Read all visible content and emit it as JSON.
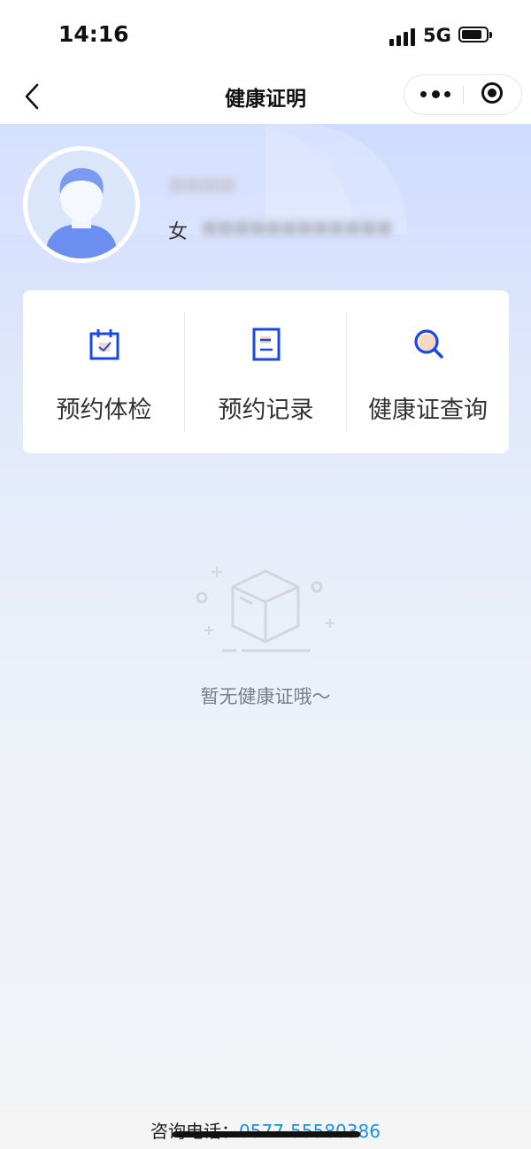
{
  "status_bar": {
    "time": "14:16",
    "network": "5G"
  },
  "nav": {
    "title": "健康证明"
  },
  "profile": {
    "name": "■■■■",
    "gender": "女",
    "id": "■■■■■■■■■■■■"
  },
  "menu": [
    {
      "label": "预约体检",
      "icon": "calendar-check-icon"
    },
    {
      "label": "预约记录",
      "icon": "document-icon"
    },
    {
      "label": "健康证查询",
      "icon": "search-icon"
    }
  ],
  "empty": {
    "text": "暂无健康证哦～"
  },
  "footer": {
    "label": "咨询电话：",
    "phone": "0577-55580386"
  },
  "colors": {
    "accent": "#1a47e8",
    "phone_link": "#1f8fe0"
  }
}
